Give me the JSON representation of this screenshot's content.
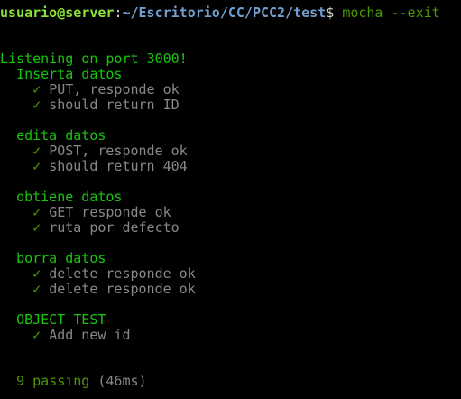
{
  "prompt": {
    "user_host": "usuario@server",
    "separator": ":",
    "path": "~/Escritorio/CC/PCC2/test",
    "symbol": "$",
    "command": "mocha --exit"
  },
  "server_message": "Listening on port 3000!",
  "check_glyph": "✓",
  "suites": [
    {
      "title": "Inserta datos",
      "tests": [
        "PUT, responde ok",
        "should return ID"
      ]
    },
    {
      "title": "edita datos",
      "tests": [
        "POST, responde ok",
        "should return 404"
      ]
    },
    {
      "title": "obtiene datos",
      "tests": [
        "GET responde ok",
        "ruta por defecto"
      ]
    },
    {
      "title": "borra datos",
      "tests": [
        "delete responde ok",
        "delete responde ok"
      ]
    },
    {
      "title": "OBJECT TEST",
      "tests": [
        "Add new id"
      ]
    }
  ],
  "summary": {
    "passing": "9 passing",
    "duration": "(46ms)"
  },
  "colors": {
    "user": "#8ae234",
    "path": "#729fcf",
    "suite": "#16c60c",
    "check": "#4e9a06",
    "test": "#888888"
  }
}
